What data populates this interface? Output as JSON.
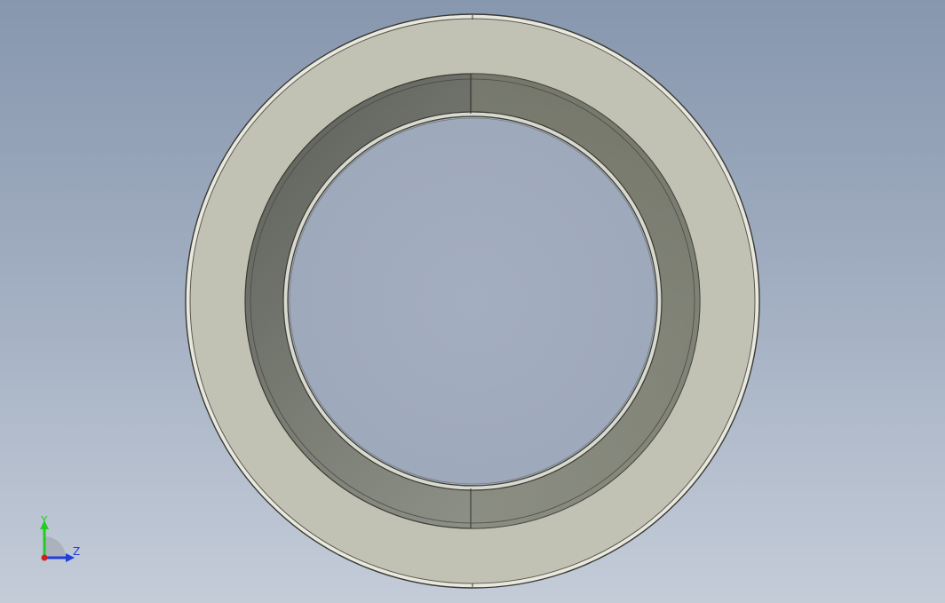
{
  "viewport": {
    "background_top": "#8797ae",
    "background_bottom": "#c4ccd8"
  },
  "model": {
    "name": "bearing-ring",
    "face_color": "#c2c2b4",
    "bore_shadow_color": "#6b6d62",
    "edge_color": "#3a3a34"
  },
  "triad": {
    "x_label": "",
    "y_label": "Y",
    "z_label": "Z",
    "y_color": "#22cc22",
    "z_color": "#1f3fd8",
    "origin_color": "#d02020"
  }
}
